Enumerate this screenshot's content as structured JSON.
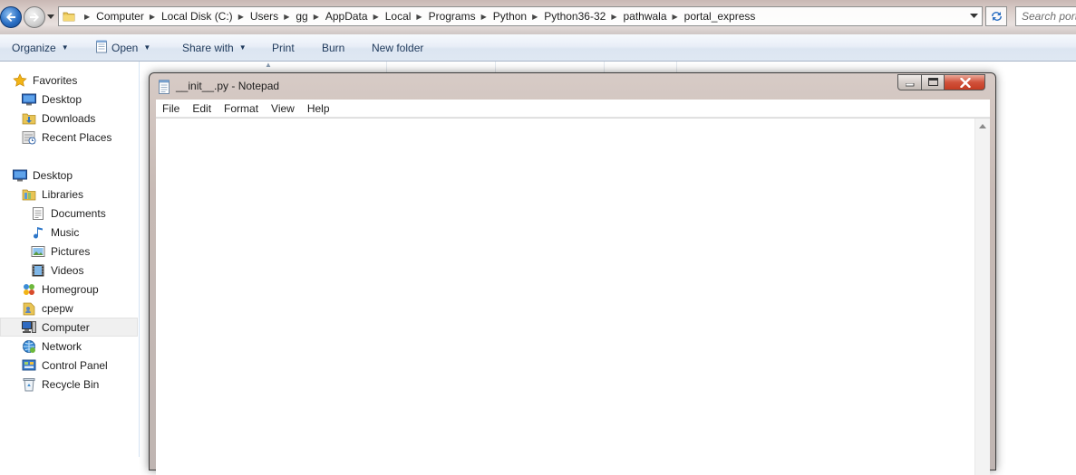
{
  "explorer": {
    "breadcrumbs": [
      "Computer",
      "Local Disk (C:)",
      "Users",
      "gg",
      "AppData",
      "Local",
      "Programs",
      "Python",
      "Python36-32",
      "pathwala",
      "portal_express"
    ],
    "search_placeholder": "Search portal_express",
    "toolbar": {
      "organize": "Organize",
      "open": "Open",
      "share_with": "Share with",
      "print": "Print",
      "burn": "Burn",
      "new_folder": "New folder"
    },
    "nav": {
      "favorites": "Favorites",
      "desktop_fav": "Desktop",
      "downloads": "Downloads",
      "recent_places": "Recent Places",
      "desktop": "Desktop",
      "libraries": "Libraries",
      "documents": "Documents",
      "music": "Music",
      "pictures": "Pictures",
      "videos": "Videos",
      "homegroup": "Homegroup",
      "cpepw": "cpepw",
      "computer": "Computer",
      "network": "Network",
      "control_panel": "Control Panel",
      "recycle_bin": "Recycle Bin"
    }
  },
  "notepad": {
    "title": "__init__.py - Notepad",
    "menu": {
      "file": "File",
      "edit": "Edit",
      "format": "Format",
      "view": "View",
      "help": "Help"
    },
    "content": ""
  },
  "colors": {
    "command_text": "#1e395b",
    "selection_bg": "#f0f0f0",
    "close_button": "#c43c22",
    "back_button": "#2a6fc4"
  }
}
